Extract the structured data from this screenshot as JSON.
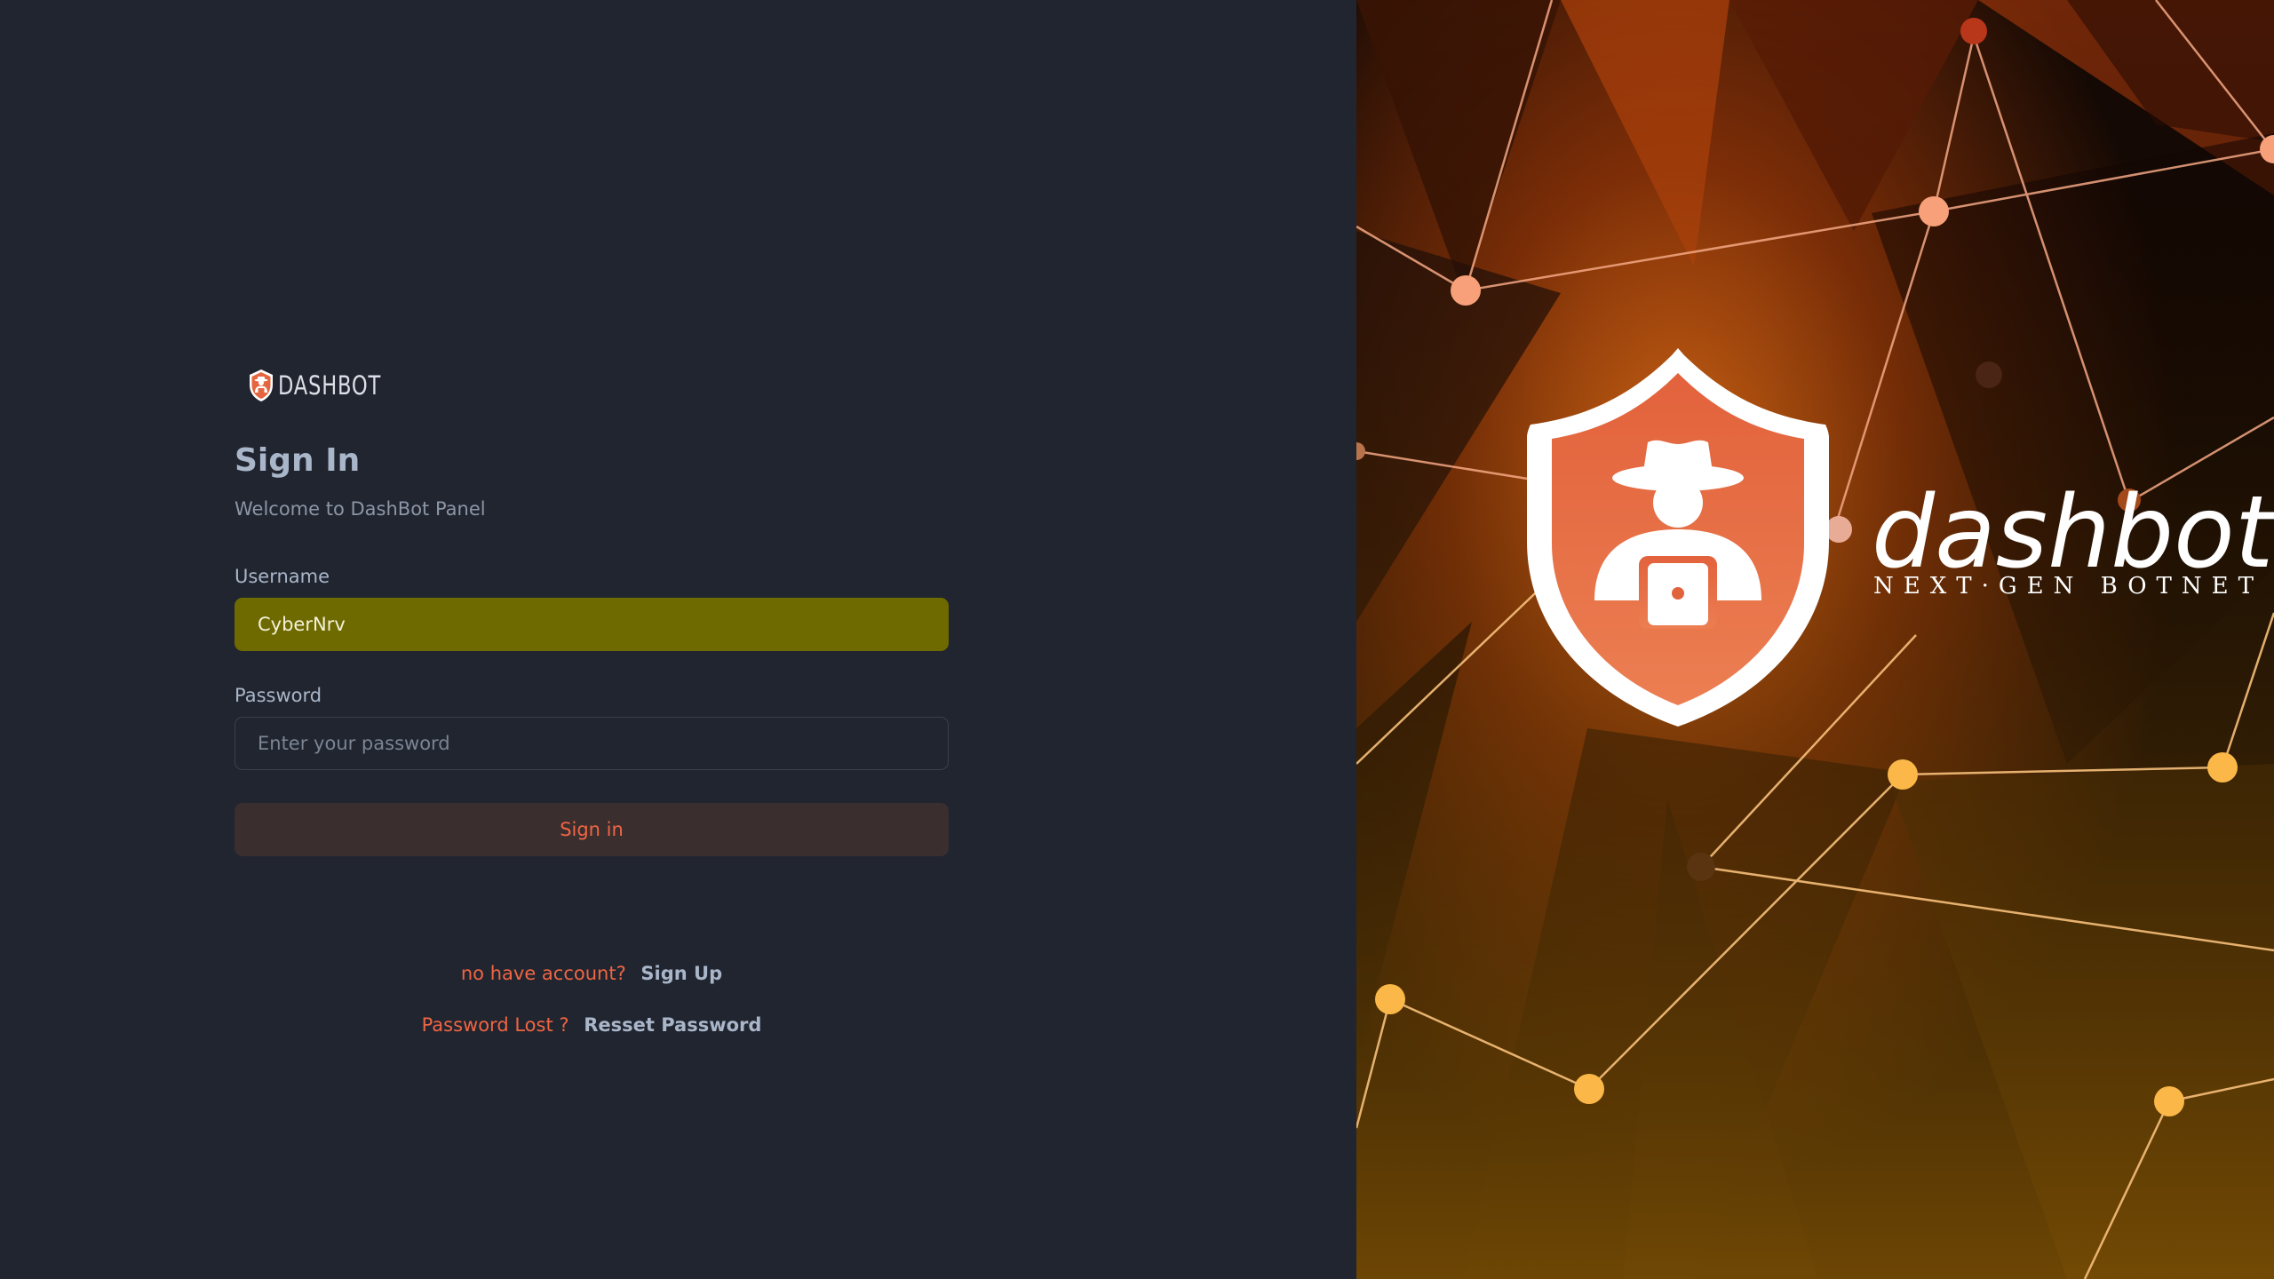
{
  "brand": {
    "name": "DASHBOT",
    "icon": "shield-hacker-icon"
  },
  "form": {
    "title": "Sign In",
    "subtitle": "Welcome to DashBot Panel",
    "username_label": "Username",
    "username_value": "CyberNrv",
    "password_label": "Password",
    "password_placeholder": "Enter your password",
    "submit_label": "Sign in"
  },
  "links": {
    "no_account_text": "no have account?",
    "signup_label": "Sign Up",
    "password_lost_text": "Password Lost ?",
    "reset_label": "Resset Password"
  },
  "hero": {
    "logo_word": "dashbot",
    "tagline": "NEXT·GEN BOTNET",
    "logo_icon": "shield-hacker-icon"
  },
  "colors": {
    "background": "#21252f",
    "accent": "#f06543",
    "username_fill": "#6e6a00",
    "button_bg": "#3a2e2f",
    "label": "#a9b6c9"
  }
}
